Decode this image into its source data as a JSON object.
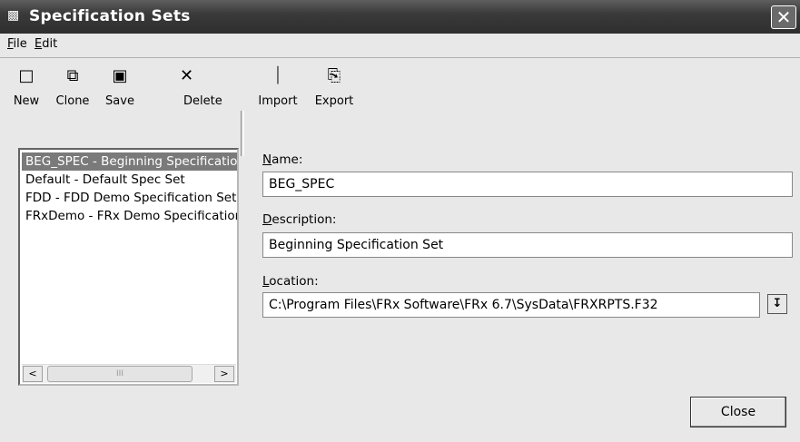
{
  "window": {
    "title": "Specification Sets",
    "title_icon": "window-icon",
    "close_glyph": "✕"
  },
  "menu": {
    "items": [
      {
        "key": "F",
        "rest": "ile"
      },
      {
        "key": "E",
        "rest": "dit"
      }
    ]
  },
  "toolbar": {
    "buttons": [
      {
        "label": "New",
        "icon": "new-document-icon",
        "glyph": "🗋"
      },
      {
        "label": "Clone",
        "icon": "copy-icon",
        "glyph": "⎘"
      },
      {
        "label": "Save",
        "icon": "save-icon",
        "glyph": "🖫"
      },
      {
        "label": "Delete",
        "icon": "delete-icon",
        "glyph": "✕"
      },
      {
        "label": "Import",
        "icon": "import-icon",
        "glyph": "⎗"
      },
      {
        "label": "Export",
        "icon": "export-icon",
        "glyph": "⎘"
      }
    ]
  },
  "spec_list": {
    "items": [
      "BEG_SPEC - Beginning Specification Set",
      "Default - Default Spec Set",
      "FDD - FDD Demo Specification Set",
      "FRxDemo - FRx Demo Specification Set"
    ],
    "selected_index": 0,
    "scroll_left": "<",
    "scroll_right": ">",
    "thumb_grip": "III"
  },
  "fields": {
    "name": {
      "label_key": "N",
      "label_rest": "ame:",
      "value": "BEG_SPEC"
    },
    "description": {
      "label_key": "D",
      "label_rest": "escription:",
      "value": "Beginning Specification Set"
    },
    "location": {
      "label_key": "L",
      "label_rest": "ocation:",
      "value": "C:\\Program Files\\FRx Software\\FRx 6.7\\SysData\\FRXRPTS.F32",
      "dropdown_glyph": "⭳"
    }
  },
  "buttons": {
    "close": "Close"
  }
}
